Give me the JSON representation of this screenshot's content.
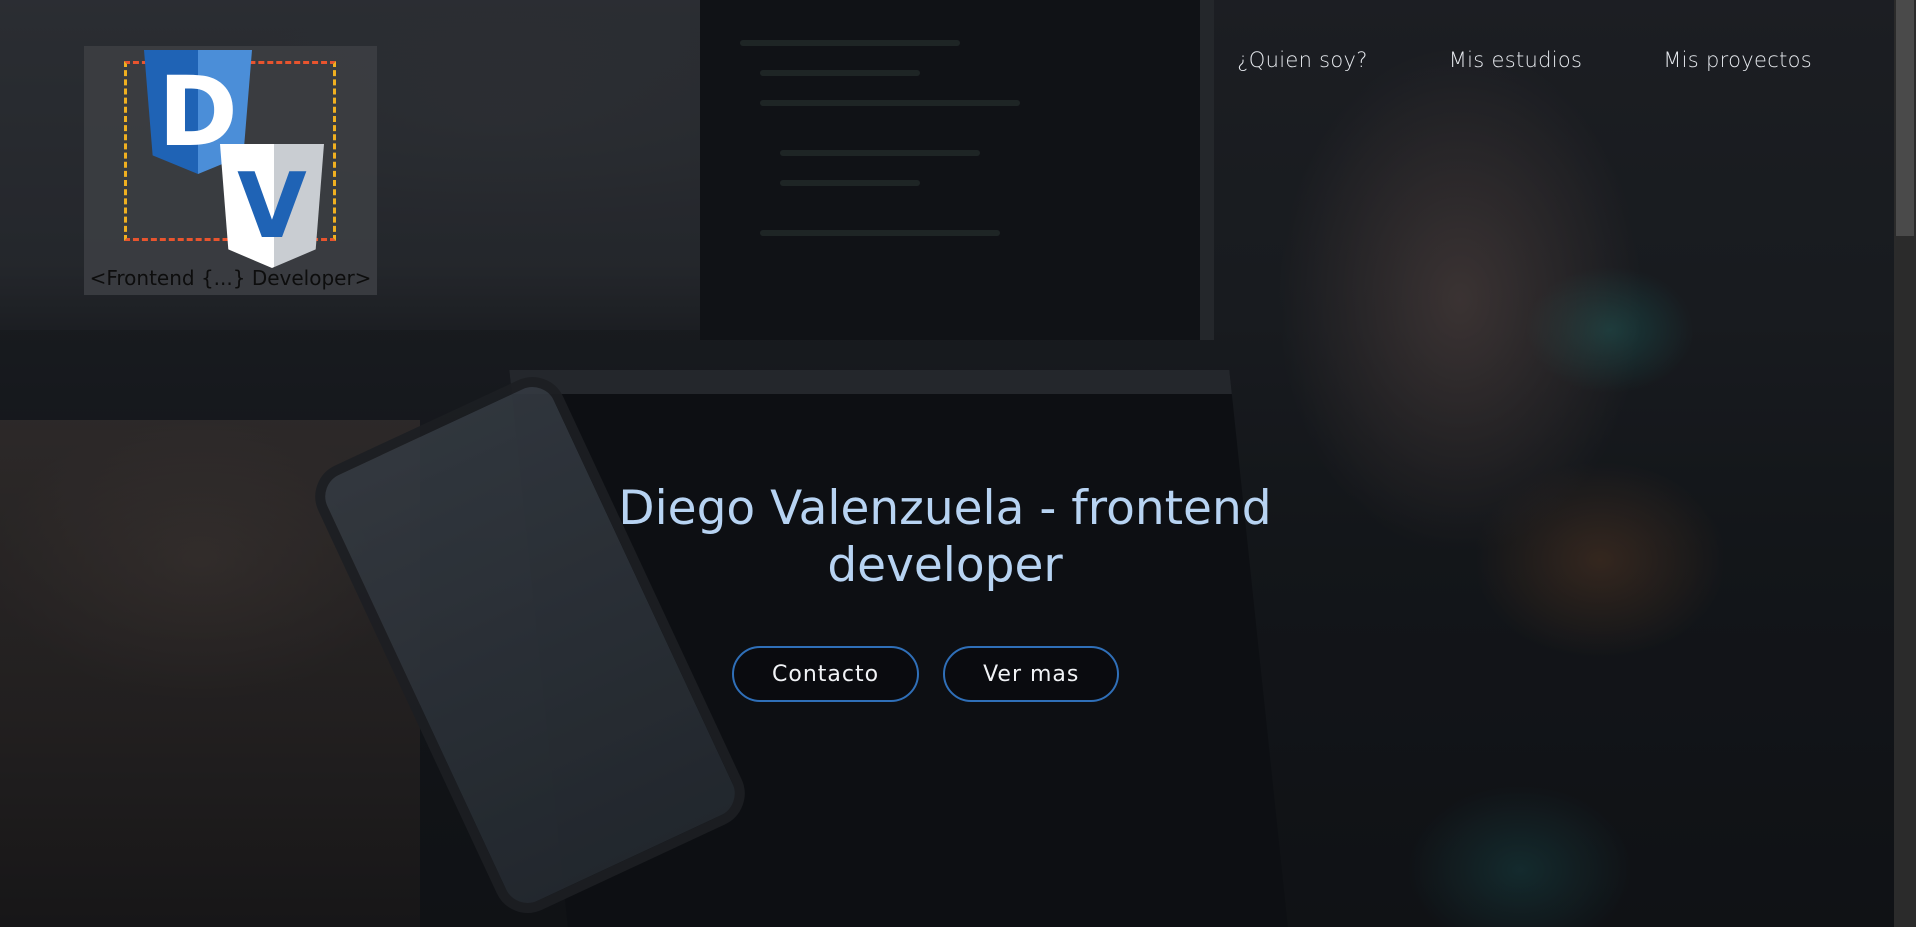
{
  "logo": {
    "letter_top": "D",
    "letter_bottom": "V",
    "caption": "<Frontend {...} Developer>",
    "colors": {
      "primary_blue": "#1f63b5",
      "accent_orange": "#e8542e",
      "accent_yellow": "#f0b020"
    }
  },
  "nav": {
    "items": [
      {
        "label": "¿Quien soy?"
      },
      {
        "label": "Mis estudios"
      },
      {
        "label": "Mis proyectos"
      }
    ]
  },
  "hero": {
    "title": "Diego Valenzuela - frontend developer",
    "buttons": {
      "contact_label": "Contacto",
      "more_label": "Ver mas"
    },
    "colors": {
      "title": "#b7d3f2",
      "button_border": "#2f6fb8"
    }
  }
}
